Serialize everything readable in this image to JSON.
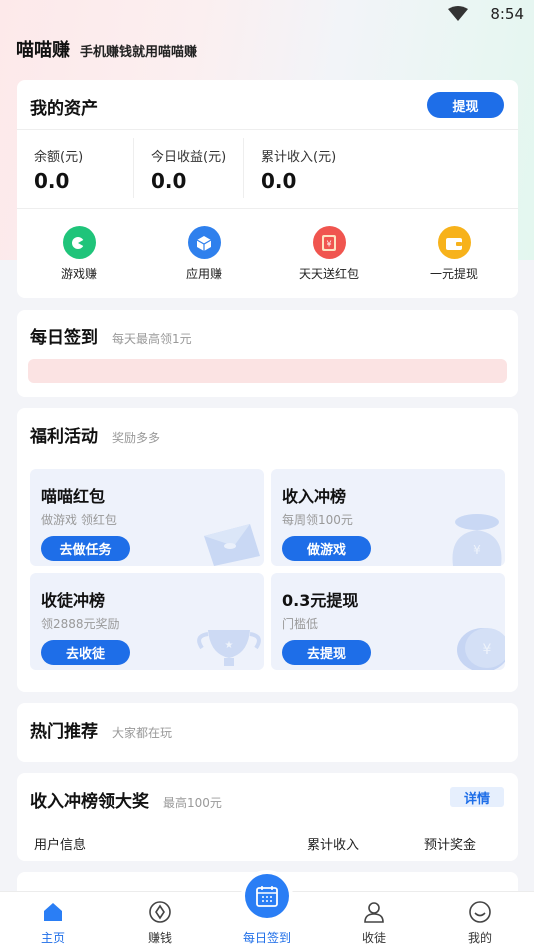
{
  "status_bar": {
    "time": "8:54"
  },
  "brand": {
    "name": "喵喵赚",
    "slogan": "手机赚钱就用喵喵赚"
  },
  "assets": {
    "title": "我的资产",
    "withdraw_label": "提现",
    "stats": [
      {
        "label": "余额(元)",
        "value": "0.0"
      },
      {
        "label": "今日收益(元)",
        "value": "0.0"
      },
      {
        "label": "累计收入(元)",
        "value": "0.0"
      }
    ],
    "quick": [
      {
        "label": "游戏赚",
        "icon": "gamepad-icon",
        "color": "#1fc47a"
      },
      {
        "label": "应用赚",
        "icon": "cube-icon",
        "color": "#2f80ed"
      },
      {
        "label": "天天送红包",
        "icon": "red-envelope-icon",
        "color": "#f0554f"
      },
      {
        "label": "一元提现",
        "icon": "wallet-icon",
        "color": "#f7b21b"
      }
    ]
  },
  "checkin": {
    "title": "每日签到",
    "subtitle": "每天最高领1元"
  },
  "welfare": {
    "title": "福利活动",
    "subtitle": "奖励多多",
    "tiles": [
      {
        "title": "喵喵红包",
        "subtitle": "做游戏 领红包",
        "button": "去做任务"
      },
      {
        "title": "收入冲榜",
        "subtitle": "每周领100元",
        "button": "做游戏"
      },
      {
        "title": "收徒冲榜",
        "subtitle": "领2888元奖励",
        "button": "去收徒"
      },
      {
        "title": "0.3元提现",
        "subtitle": "门槛低",
        "button": "去提现"
      }
    ]
  },
  "hot": {
    "title": "热门推荐",
    "subtitle": "大家都在玩"
  },
  "ranking": {
    "title": "收入冲榜领大奖",
    "subtitle": "最高100元",
    "detail_label": "详情",
    "columns": [
      "用户信息",
      "累计收入",
      "预计奖金"
    ]
  },
  "tabs": [
    {
      "label": "主页",
      "icon": "home-icon",
      "active": true
    },
    {
      "label": "赚钱",
      "icon": "compass-icon",
      "active": false
    },
    {
      "label": "每日签到",
      "icon": "calendar-icon",
      "active": false
    },
    {
      "label": "收徒",
      "icon": "person-icon",
      "active": false
    },
    {
      "label": "我的",
      "icon": "smile-icon",
      "active": false
    }
  ],
  "colors": {
    "accent": "#1e6ee8",
    "checkin_bar": "#fbe3e3"
  }
}
